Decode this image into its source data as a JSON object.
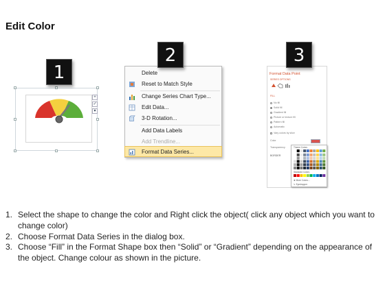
{
  "title": "Edit Color",
  "badges": [
    "1",
    "2",
    "3"
  ],
  "menu": {
    "items": [
      {
        "label": "Delete",
        "icon": "delete-icon",
        "disabled": false
      },
      {
        "label": "Reset to Match Style",
        "icon": "reset-style-icon",
        "disabled": false
      },
      {
        "label": "Change Series Chart Type...",
        "icon": "chart-type-icon",
        "disabled": false
      },
      {
        "label": "Edit Data...",
        "icon": "edit-data-icon",
        "disabled": false
      },
      {
        "label": "3-D Rotation...",
        "icon": "rotation-icon",
        "disabled": false
      },
      {
        "label": "Add Data Labels",
        "icon": "",
        "disabled": false
      },
      {
        "label": "Add Trendline...",
        "icon": "",
        "disabled": true
      },
      {
        "label": "Format Data Series...",
        "icon": "format-series-icon",
        "disabled": false
      }
    ]
  },
  "pane": {
    "title": "Format Data Point",
    "subtitle": "SERIES OPTIONS",
    "section": "FILL",
    "options": [
      "No fill",
      "Solid fill",
      "Gradient fill",
      "Picture or texture fill",
      "Pattern fill",
      "Automatic"
    ],
    "vary_label": "Vary colors by slice",
    "color_label": "Color",
    "transparency_label": "Transparency",
    "border_label": "BORDER",
    "palette": {
      "theme_label": "Theme Colors",
      "standard_label": "Standard Colors",
      "more_label": "More Colors...",
      "eyedropper_label": "Eyedropper"
    }
  },
  "steps": [
    {
      "num": "1.",
      "text": "Select the shape to change the color and Right click the object( click any object which you want to change color)"
    },
    {
      "num": "2.",
      "text": "Choose Format Data Series in the dialog box."
    },
    {
      "num": "3.",
      "text": "Choose “Fill” in the Format Shape box then “Solid” or “Gradient” depending on the appearance of the object. Change colour as shown in the picture."
    }
  ],
  "colors": {
    "gauge_red": "#d9342b",
    "gauge_yellow": "#f4d03f",
    "gauge_green": "#5cae3a",
    "highlight": "#fde8a6",
    "accent": "#d35230"
  }
}
